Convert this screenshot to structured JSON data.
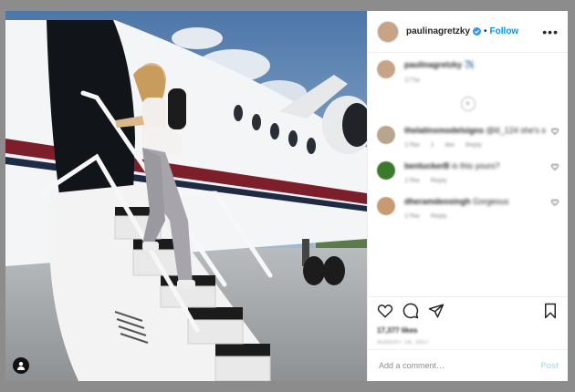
{
  "post": {
    "username": "paulinagretzky",
    "follow_label": "Follow",
    "separator": "•",
    "more_label": "•••",
    "caption": {
      "username": "paulinagretzky",
      "text": "✈️",
      "age": "177w"
    },
    "comments": [
      {
        "username": "thelatinxmodelsigns",
        "text": "@lil_124 she's so cute !",
        "age": "176w",
        "likes": "1 like",
        "reply": "Reply",
        "avatar_color": "#b9a48e"
      },
      {
        "username": "bentuckerB",
        "text": "is this yours?",
        "age": "176w",
        "likes": "",
        "reply": "Reply",
        "avatar_color": "#3a7a2a"
      },
      {
        "username": "dheramdeosingh",
        "text": "Gorgeous",
        "age": "176w",
        "likes": "",
        "reply": "Reply",
        "avatar_color": "#c79a72"
      }
    ],
    "likes_text": "17,377 likes",
    "date_text": "AUGUST 14, 2017",
    "comment_placeholder": "Add a comment…",
    "post_label": "Post"
  },
  "colors": {
    "accent": "#0095f6",
    "post_disabled": "#b2dffc",
    "backdrop": "#8c8c8c"
  },
  "icons": {
    "verified": "verified-badge-icon",
    "like": "heart-icon",
    "comment": "comment-icon",
    "share": "paper-plane-icon",
    "save": "bookmark-icon",
    "load_more": "plus-circle-icon",
    "user_tag": "user-icon"
  }
}
